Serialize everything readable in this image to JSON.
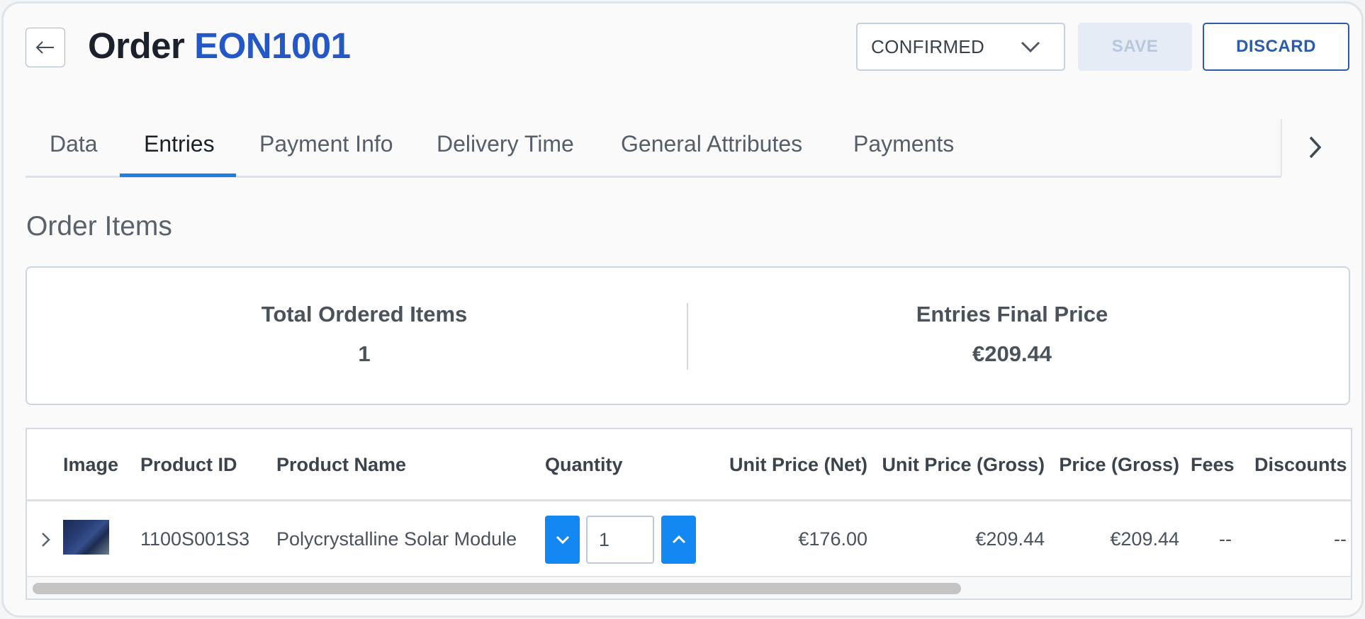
{
  "header": {
    "title_prefix": "Order",
    "order_id": "EON1001",
    "status_value": "CONFIRMED",
    "save_label": "SAVE",
    "discard_label": "DISCARD"
  },
  "tabs": [
    {
      "label": "Data"
    },
    {
      "label": "Entries",
      "active": true
    },
    {
      "label": "Payment Info"
    },
    {
      "label": "Delivery Time"
    },
    {
      "label": "General Attributes"
    },
    {
      "label": "Payments"
    }
  ],
  "section_title": "Order Items",
  "summary": {
    "total_items_label": "Total Ordered Items",
    "total_items_value": "1",
    "final_price_label": "Entries Final Price",
    "final_price_value": "€209.44"
  },
  "table": {
    "columns": {
      "image": "Image",
      "product_id": "Product ID",
      "product_name": "Product Name",
      "quantity": "Quantity",
      "unit_price_net": "Unit Price (Net)",
      "unit_price_gross": "Unit Price (Gross)",
      "price_gross": "Price (Gross)",
      "fees": "Fees",
      "discounts": "Discounts"
    },
    "rows": [
      {
        "product_id": "1100S001S3",
        "product_name": "Polycrystalline Solar Module",
        "quantity": "1",
        "unit_price_net": "€176.00",
        "unit_price_gross": "€209.44",
        "price_gross": "€209.44",
        "fees": "--",
        "discounts": "--"
      }
    ]
  },
  "colors": {
    "accent": "#1387f2",
    "order_id": "#2458c6",
    "discard": "#2a5cab"
  },
  "icons": {
    "back": "arrow-left-icon",
    "status": "chevron-down-icon",
    "tabs_next": "chevron-right-icon",
    "row_expand": "chevron-right-icon",
    "qty_down": "chevron-down-icon",
    "qty_up": "chevron-up-icon"
  }
}
